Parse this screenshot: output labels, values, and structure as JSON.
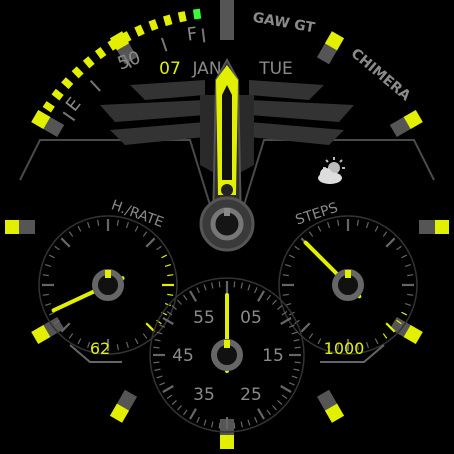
{
  "watch": {
    "brand_line1": "GAW GT",
    "brand_line2": "CHIMERA",
    "colors": {
      "accent": "#e2f000",
      "bright_green": "#33ff33",
      "bezel_gray": "#555555",
      "text_gray": "#8a8a8a",
      "background": "#000000"
    }
  },
  "date": {
    "day": "07",
    "month": "JAN",
    "weekday": "TUE"
  },
  "fuel_gauge": {
    "scale_labels": [
      "E",
      "50",
      "F"
    ],
    "level": 0.92
  },
  "weather": {
    "icon": "partly-cloudy-icon"
  },
  "heart_rate": {
    "label": "H./RATE",
    "value": "62"
  },
  "steps": {
    "label": "STEPS",
    "value": "1000"
  },
  "seconds_dial": {
    "labels": [
      "55",
      "05",
      "45",
      "15",
      "35",
      "25"
    ]
  },
  "time": {
    "hour": 12,
    "minute": 0,
    "second": 0
  }
}
